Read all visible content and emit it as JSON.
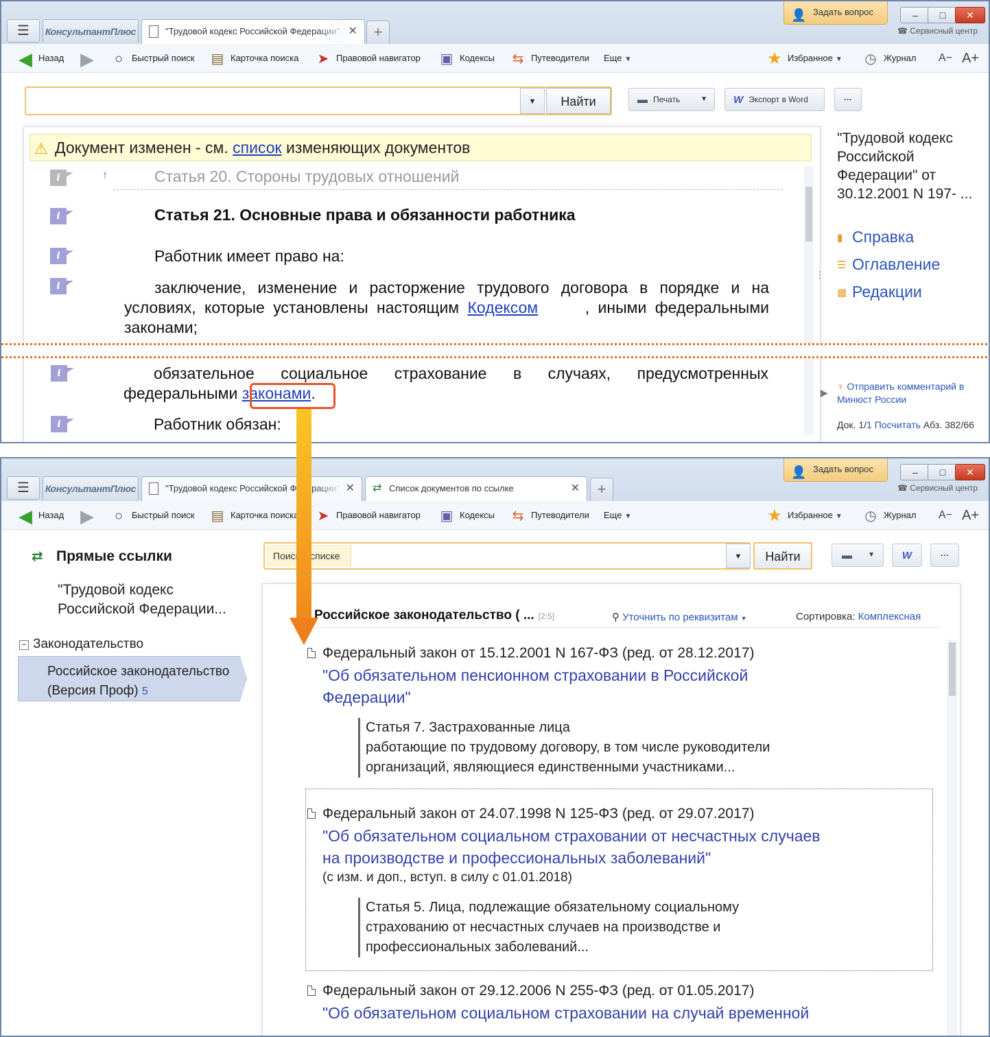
{
  "app": {
    "logo": "КонсультантПлюс",
    "ask_question": "Задать вопрос",
    "service_center": "Сервисный центр",
    "window_controls": [
      "–",
      "□",
      "✕"
    ]
  },
  "toolbar": {
    "back": "Назад",
    "quick_search": "Быстрый поиск",
    "search_card": "Карточка поиска",
    "legal_navigator": "Правовой навигатор",
    "codes": "Кодексы",
    "guides": "Путеводители",
    "more": "Еще",
    "favorites": "Избранное",
    "journal": "Журнал",
    "font_decrease": "A−",
    "font_increase": "A+"
  },
  "window1": {
    "tab": "\"Трудовой кодекс Российской Федерации\"",
    "search": {
      "value": "",
      "find_label": "Найти"
    },
    "print_label": "Печать",
    "export_label": "Экспорт в Word",
    "more_label": "···",
    "notice": {
      "before": "Документ изменен - см. ",
      "link": "список",
      "after": " изменяющих документов"
    },
    "document": {
      "prev_article": "Статья 20. Стороны трудовых отношений",
      "article": "Статья 21. Основные права и обязанности работника",
      "p1": "Работник имеет право на:",
      "p2_indent": "заключение, изменение и расторжение трудового договора в порядке и на",
      "p2_mid_before": "условиях, которые установлены настоящим ",
      "p2_link": "Кодексом",
      "p2_mid_after": ", иными федеральными",
      "p2_end": "законами;",
      "p3_indent": "обязательное социальное страхование в случаях, предусмотренных",
      "p3_before": "федеральными ",
      "p3_link": "законами",
      "p3_after": ".",
      "p4": "Работник обязан:"
    },
    "right_panel": {
      "doc_title": "\"Трудовой кодекс Российской Федерации\" от 30.12.2001 N 197- ...",
      "help": "Справка",
      "contents": "Оглавление",
      "editions": "Редакции",
      "feedback": "Отправить комментарий в Минюст России",
      "status_prefix": "Док. 1/",
      "status_total": "1",
      "status_count": "Посчитать",
      "status_para": "Абз. 382/66"
    }
  },
  "window2": {
    "tab1": "\"Трудовой кодекс Российской Федерации\"",
    "tab2": "Список документов по ссылке",
    "left_panel": {
      "heading": "Прямые ссылки",
      "doc": "\"Трудовой кодекс Российской Федерации...",
      "group": "Законодательство",
      "item": "Российское законодательство (Версия Проф)",
      "item_count": "5"
    },
    "list_search": {
      "label": "Поиск в списке",
      "value": "",
      "find_label": "Найти"
    },
    "results_header": {
      "title": "Российское законодательство ( ...",
      "count": "[2:5]",
      "refine": "Уточнить по реквизитам",
      "sort_label": "Сортировка: ",
      "sort_value": "Комплексная"
    },
    "results": [
      {
        "line": "Федеральный закон от 15.12.2001 N 167-ФЗ (ред. от 28.12.2017)",
        "title_1": "\"Об обязательном пенсионном страховании в Российской",
        "title_2": "Федерации\"",
        "quote_1": "Статья 7. Застрахованные лица",
        "quote_2": "работающие по трудовому договору, в том числе руководители",
        "quote_3": "организаций, являющиеся единственными участниками..."
      },
      {
        "line": "Федеральный закон от 24.07.1998 N 125-ФЗ (ред. от 29.07.2017)",
        "title_1": "\"Об обязательном социальном страховании от несчастных случаев",
        "title_2": "на производстве и профессиональных заболеваний\"",
        "sub": "(с изм. и доп., вступ. в силу с 01.01.2018)",
        "quote_1": "Статья 5. Лица, подлежащие обязательному социальному",
        "quote_2": "страхованию от несчастных случаев на производстве и",
        "quote_3": "профессиональных заболеваний..."
      },
      {
        "line": "Федеральный закон от 29.12.2006 N 255-ФЗ (ред. от 01.05.2017)",
        "title_1": "\"Об обязательном социальном страховании на случай временной"
      }
    ]
  },
  "colors": {
    "accent_link": "#1f3fbf",
    "highlight": "#e6552a",
    "arrow": "#f08a1c",
    "notice_bg": "#fffbd5"
  }
}
